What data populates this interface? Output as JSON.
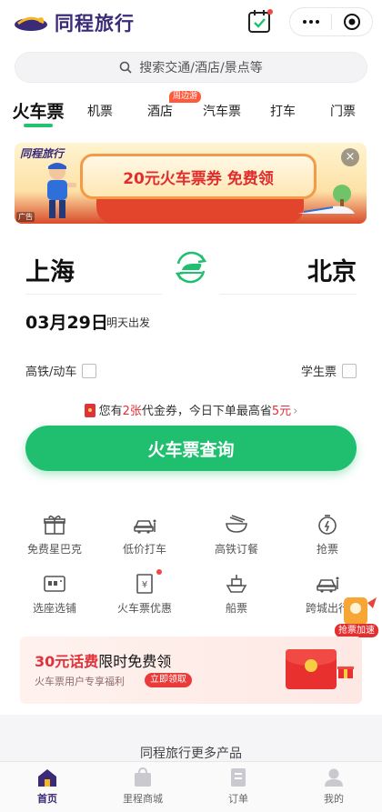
{
  "header": {
    "brand": "同程旅行",
    "calendar_icon": "calendar-check-icon",
    "more_icon": "more-dots-icon",
    "close_icon": "target-circle-icon"
  },
  "search": {
    "placeholder": "搜索交通/酒店/景点等",
    "icon": "search-icon"
  },
  "tabs": [
    {
      "label": "火车票",
      "active": true
    },
    {
      "label": "机票"
    },
    {
      "label": "酒店",
      "badge": "周边游"
    },
    {
      "label": "汽车票"
    },
    {
      "label": "打车"
    },
    {
      "label": "门票"
    }
  ],
  "banner": {
    "brand": "同程旅行",
    "title": "20元火车票券 免费领",
    "ad_tag": "广告",
    "close": "×"
  },
  "booking": {
    "from": "上海",
    "to": "北京",
    "date": "03月29日",
    "date_note": "明天出发",
    "option_highspeed": "高铁/动车",
    "option_student": "学生票",
    "coupon_prefix": "您有",
    "coupon_count": "2张",
    "coupon_mid": "代金券，今日下单最高省",
    "coupon_amount": "5元",
    "coupon_chevron": "›",
    "query_button": "火车票查询"
  },
  "services": [
    {
      "label": "免费星巴克",
      "icon": "gift-box-icon"
    },
    {
      "label": "低价打车",
      "icon": "taxi-icon"
    },
    {
      "label": "高铁订餐",
      "icon": "meal-bowl-icon"
    },
    {
      "label": "抢票",
      "icon": "stopwatch-icon"
    },
    {
      "label": "选座选铺",
      "icon": "seat-map-icon"
    },
    {
      "label": "火车票优惠",
      "icon": "coupon-ticket-icon"
    },
    {
      "label": "船票",
      "icon": "ship-icon"
    },
    {
      "label": "跨城出行",
      "icon": "intercity-car-icon"
    }
  ],
  "floating_badge": {
    "label": "抢票加速"
  },
  "promo": {
    "title_highlight": "30元话费",
    "title_rest": "限时免费领",
    "subtitle": "火车票用户专享福利",
    "button": "立即领取"
  },
  "more_products": "同程旅行更多产品",
  "bottom_nav": [
    {
      "label": "首页",
      "icon": "home-icon",
      "active": true
    },
    {
      "label": "里程商城",
      "icon": "shopping-bag-icon"
    },
    {
      "label": "订单",
      "icon": "order-list-icon"
    },
    {
      "label": "我的",
      "icon": "user-profile-icon"
    }
  ],
  "colors": {
    "brand_purple": "#3a2a78",
    "accent_green": "#1fbf6f",
    "highlight_red": "#e0323a"
  }
}
